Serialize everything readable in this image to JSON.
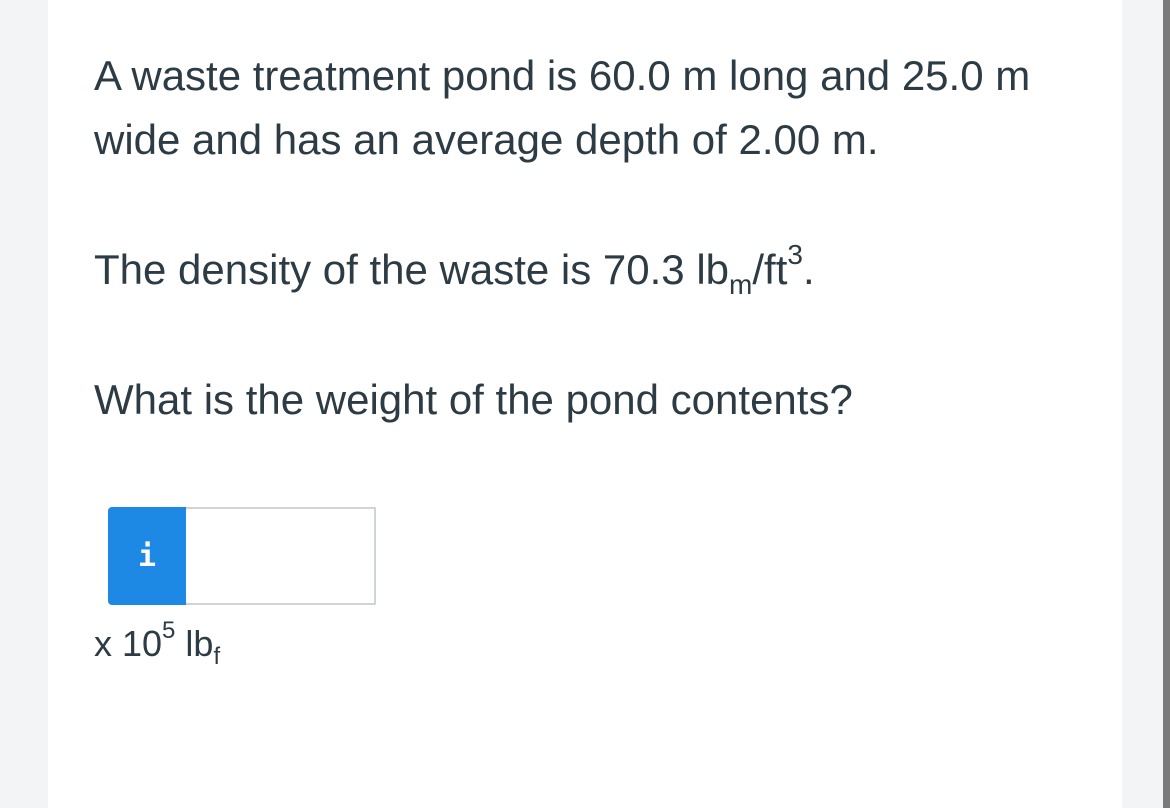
{
  "question": {
    "paragraph1": "A waste treatment pond is 60.0 m long and 25.0 m wide and has an average depth of 2.00 m.",
    "density_prefix": "The density of the waste is 70.3 lb",
    "density_sub": "m",
    "density_mid": "/ft",
    "density_sup": "3",
    "density_suffix": ".",
    "prompt": "What is the weight of the pond contents?"
  },
  "answer": {
    "info_icon_label": "i",
    "value": "",
    "multiplier_prefix": "x 10",
    "exponent": "5",
    "unit_base": " lb",
    "unit_sub": "f"
  },
  "colors": {
    "accent": "#1e88e5",
    "text": "#2d3b45"
  }
}
